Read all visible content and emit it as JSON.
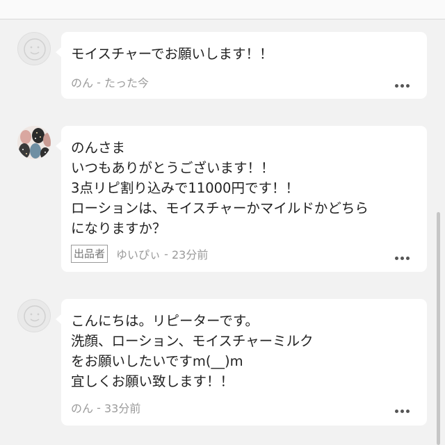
{
  "comments": [
    {
      "avatar": "default-face-icon",
      "text": "モイスチャーでお願いします！！",
      "seller_badge": "",
      "author": "のん",
      "separator": " - ",
      "time": "たった今"
    },
    {
      "avatar": "seller-photo",
      "text": "のんさま\nいつもありがとうございます！！\n3点リピ割り込みで11000円です！！\nローションは、モイスチャーかマイルドかどちら\nになりますか？",
      "seller_badge": "出品者",
      "author": "ゆいぴぃ",
      "separator": " - ",
      "time": "23分前"
    },
    {
      "avatar": "default-face-icon",
      "text": "こんにちは。リピーターです。\n洗顔、ローション、モイスチャーミルク\nをお願いしたいですm(__)m\n宜しくお願い致します！！",
      "seller_badge": "",
      "author": "のん",
      "separator": " - ",
      "time": "33分前"
    }
  ],
  "colors": {
    "background": "#f2f2f2",
    "bubble": "#ffffff",
    "meta_text": "#9a9a9a"
  }
}
